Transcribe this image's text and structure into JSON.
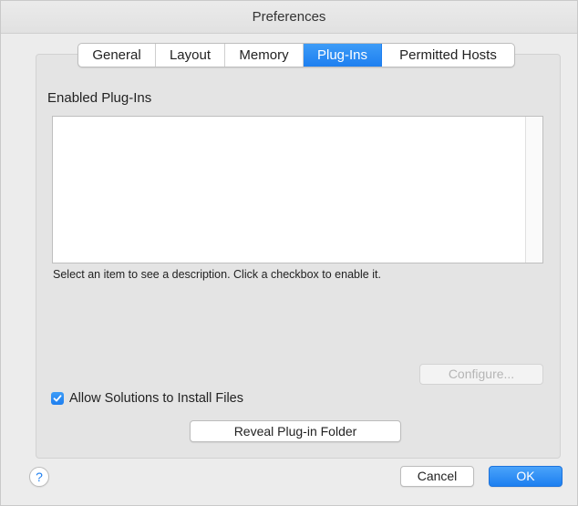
{
  "window": {
    "title": "Preferences"
  },
  "tabs": [
    {
      "label": "General",
      "active": false
    },
    {
      "label": "Layout",
      "active": false
    },
    {
      "label": "Memory",
      "active": false
    },
    {
      "label": "Plug-Ins",
      "active": true
    },
    {
      "label": "Permitted Hosts",
      "active": false
    }
  ],
  "plugins": {
    "section_label": "Enabled Plug-Ins",
    "items": [],
    "hint": "Select an item to see a description. Click a checkbox to enable it.",
    "configure_label": "Configure...",
    "configure_enabled": false,
    "allow_install_label": "Allow Solutions to Install Files",
    "allow_install_checked": true,
    "reveal_folder_label": "Reveal Plug-in Folder"
  },
  "footer": {
    "help_label": "?",
    "cancel_label": "Cancel",
    "ok_label": "OK"
  },
  "colors": {
    "accent": "#1e7ff0",
    "window_bg": "#ececec",
    "panel_bg": "#e4e4e4"
  },
  "icons": {
    "checkbox_checked": "checkmark-icon",
    "help": "question-icon"
  }
}
